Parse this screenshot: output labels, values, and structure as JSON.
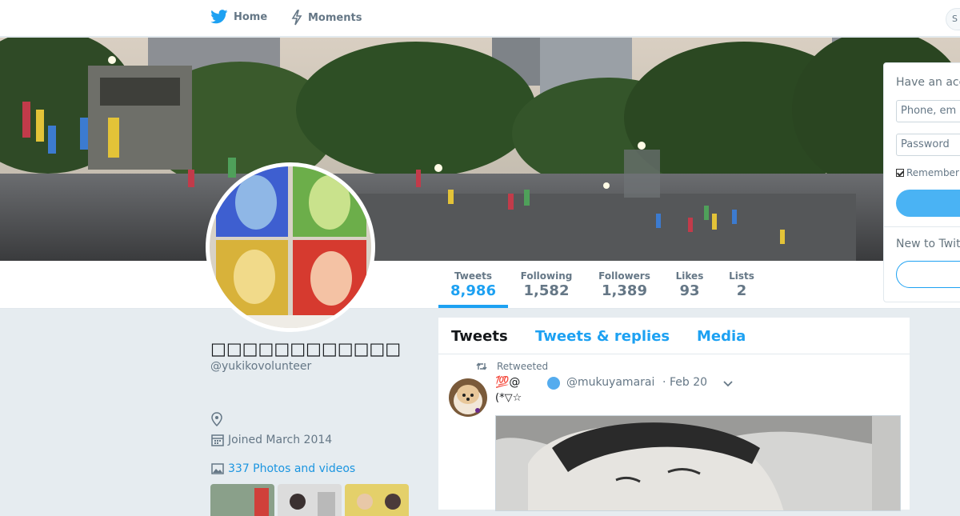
{
  "nav": {
    "home_label": "Home",
    "moments_label": "Moments",
    "search_stub": "S"
  },
  "profile": {
    "name": "□□□□□□□□□□□□",
    "handle": "@yukikovolunteer",
    "joined": "Joined March 2014",
    "photos_link": "337 Photos and videos"
  },
  "stats": [
    {
      "label": "Tweets",
      "value": "8,986"
    },
    {
      "label": "Following",
      "value": "1,582"
    },
    {
      "label": "Followers",
      "value": "1,389"
    },
    {
      "label": "Likes",
      "value": "93"
    },
    {
      "label": "Lists",
      "value": "2"
    }
  ],
  "timeline": {
    "tabs": [
      "Tweets",
      "Tweets & replies",
      "Media"
    ],
    "retweet_label": "Retweeted",
    "tweet": {
      "name_line1": "💯@",
      "name_line2": "(*▽☆",
      "handle": "@mukuyamarai",
      "separator": "·",
      "date": "Feb 20"
    }
  },
  "login": {
    "title": "Have an acc",
    "phone_placeholder": "Phone, em",
    "password_placeholder": "Password",
    "remember_label": "Remember",
    "signup_title": "New to Twit"
  },
  "colors": {
    "accent": "#1da1f2",
    "link": "#1b95e0",
    "muted": "#657786",
    "background": "#e6ecf0"
  }
}
